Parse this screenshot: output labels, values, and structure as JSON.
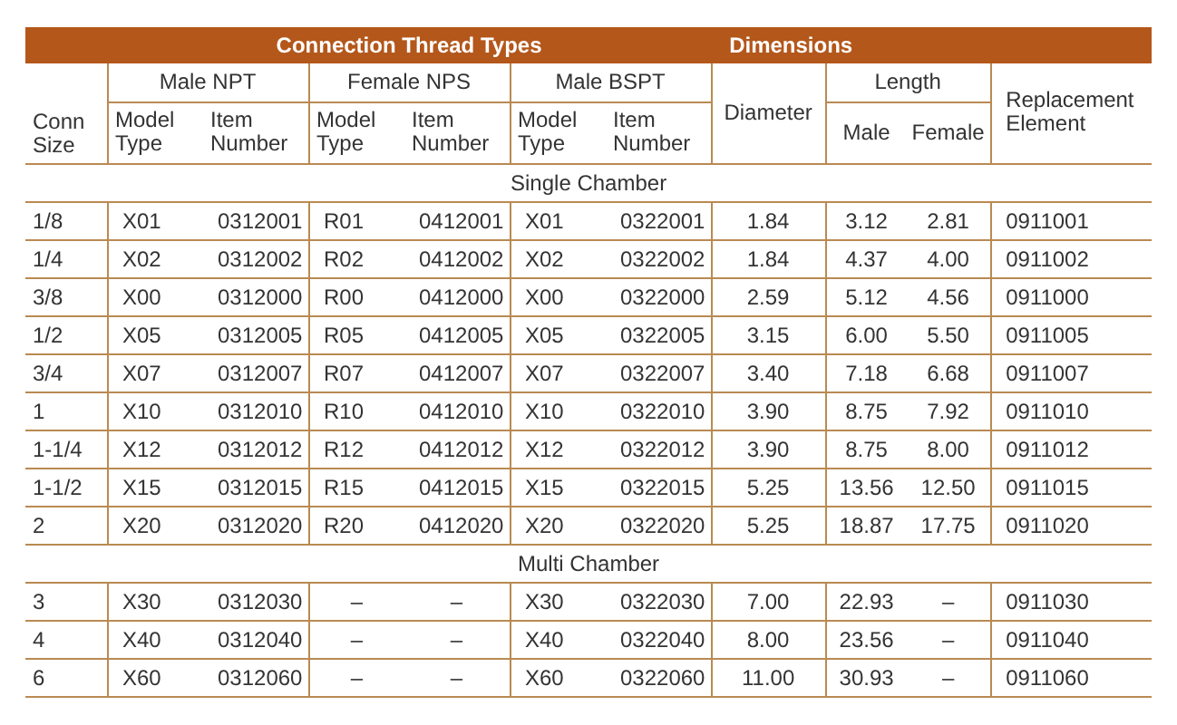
{
  "table": {
    "top_headers": [
      "Connection Thread Types",
      "Dimensions"
    ],
    "conn_size": "Conn Size",
    "thread_groups": [
      {
        "title": "Male NPT",
        "columns": [
          "Model Type",
          "Item Number"
        ]
      },
      {
        "title": "Female NPS",
        "columns": [
          "Model Type",
          "Item Number"
        ]
      },
      {
        "title": "Male BSPT",
        "columns": [
          "Model Type",
          "Item Number"
        ]
      }
    ],
    "diameter": "Diameter",
    "length": {
      "title": "Length",
      "columns": [
        "Male",
        "Female"
      ]
    },
    "replacement": "Replacement Element",
    "sections": [
      {
        "title": "Single Chamber",
        "rows": [
          [
            "1/8",
            "X01",
            "0312001",
            "R01",
            "0412001",
            "X01",
            "0322001",
            "1.84",
            "3.12",
            "2.81",
            "0911001"
          ],
          [
            "1/4",
            "X02",
            "0312002",
            "R02",
            "0412002",
            "X02",
            "0322002",
            "1.84",
            "4.37",
            "4.00",
            "0911002"
          ],
          [
            "3/8",
            "X00",
            "0312000",
            "R00",
            "0412000",
            "X00",
            "0322000",
            "2.59",
            "5.12",
            "4.56",
            "0911000"
          ],
          [
            "1/2",
            "X05",
            "0312005",
            "R05",
            "0412005",
            "X05",
            "0322005",
            "3.15",
            "6.00",
            "5.50",
            "0911005"
          ],
          [
            "3/4",
            "X07",
            "0312007",
            "R07",
            "0412007",
            "X07",
            "0322007",
            "3.40",
            "7.18",
            "6.68",
            "0911007"
          ],
          [
            "1",
            "X10",
            "0312010",
            "R10",
            "0412010",
            "X10",
            "0322010",
            "3.90",
            "8.75",
            "7.92",
            "0911010"
          ],
          [
            "1-1/4",
            "X12",
            "0312012",
            "R12",
            "0412012",
            "X12",
            "0322012",
            "3.90",
            "8.75",
            "8.00",
            "0911012"
          ],
          [
            "1-1/2",
            "X15",
            "0312015",
            "R15",
            "0412015",
            "X15",
            "0322015",
            "5.25",
            "13.56",
            "12.50",
            "0911015"
          ],
          [
            "2",
            "X20",
            "0312020",
            "R20",
            "0412020",
            "X20",
            "0322020",
            "5.25",
            "18.87",
            "17.75",
            "0911020"
          ]
        ]
      },
      {
        "title": "Multi Chamber",
        "rows": [
          [
            "3",
            "X30",
            "0312030",
            "–",
            "–",
            "X30",
            "0322030",
            "7.00",
            "22.93",
            "–",
            "0911030"
          ],
          [
            "4",
            "X40",
            "0312040",
            "–",
            "–",
            "X40",
            "0322040",
            "8.00",
            "23.56",
            "–",
            "0911040"
          ],
          [
            "6",
            "X60",
            "0312060",
            "–",
            "–",
            "X60",
            "0322060",
            "11.00",
            "30.93",
            "–",
            "0911060"
          ]
        ]
      }
    ]
  }
}
